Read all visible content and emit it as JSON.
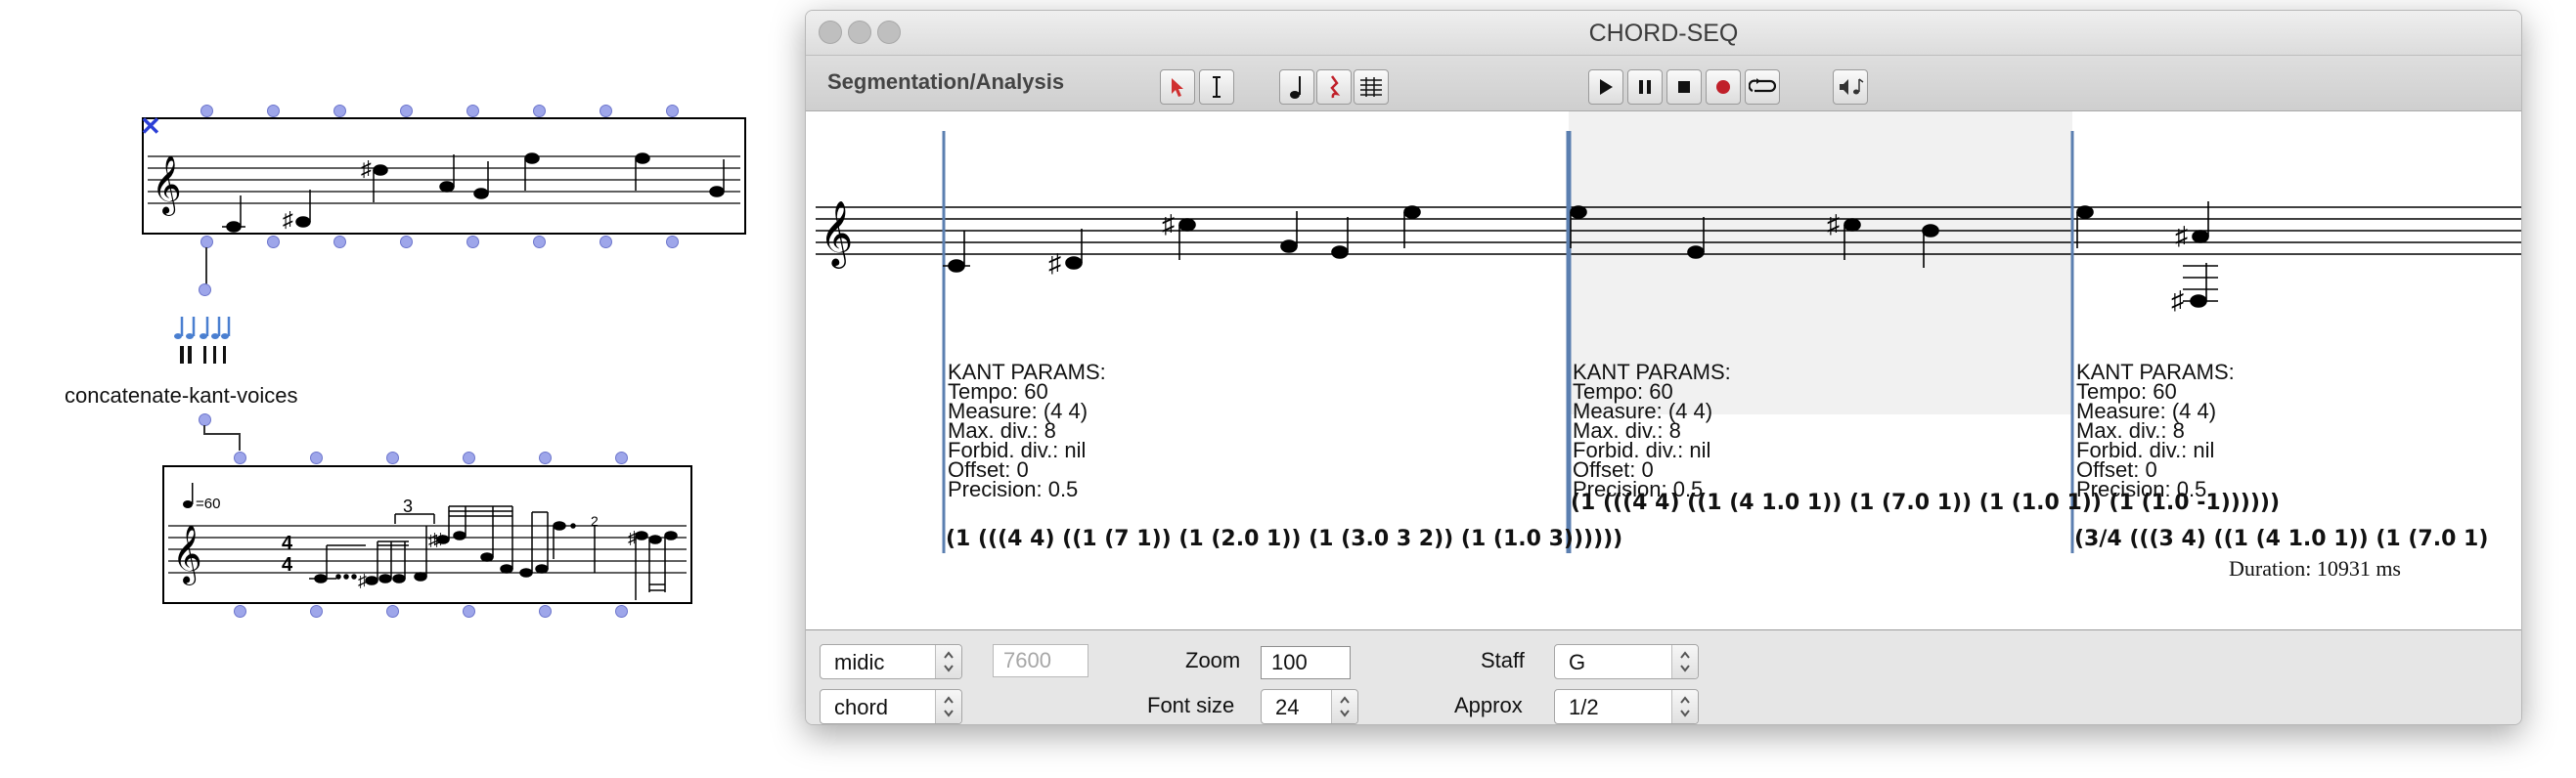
{
  "patch": {
    "kant_object_label": "concatenate-kant-voices",
    "input_score": {
      "clef": "treble-clef"
    },
    "output_score": {
      "tempo": "=60",
      "time_signature_top": "4",
      "time_signature_bottom": "4",
      "tuplet_label": "3",
      "small_number": "2"
    }
  },
  "window": {
    "title": "CHORD-SEQ",
    "toolbar": {
      "label": "Segmentation/Analysis",
      "tools": [
        "arrow-select-icon",
        "text-cursor-icon",
        "note-icon",
        "rest-icon",
        "score-grid-icon"
      ],
      "transport": [
        "play-icon",
        "pause-icon",
        "stop-icon",
        "record-icon",
        "loop-icon"
      ],
      "midi_icon": "speaker-note-icon"
    },
    "segments": [
      {
        "params_title": "KANT PARAMS:",
        "tempo": "Tempo: 60",
        "measure": "Measure: (4 4)",
        "max_div": "Max. div.: 8",
        "forbid": "Forbid. div.: nil",
        "offset": "Offset: 0",
        "precision": "Precision: 0.5",
        "tree": "(1 (((4 4) ((1 (7 1)) (1 (2.0 1)) (1 (3.0 3 2)) (1 (1.0 3))))))"
      },
      {
        "params_title": "KANT PARAMS:",
        "tempo": "Tempo: 60",
        "measure": "Measure: (4 4)",
        "max_div": "Max. div.: 8",
        "forbid": "Forbid. div.: nil",
        "offset": "Offset: 0",
        "precision": "Precision: 0.5",
        "tree": "(1 (((4 4) ((1 (4 1.0 1)) (1 (7.0 1)) (1 (1.0 1)) (1 (1.0 -1))))))"
      },
      {
        "params_title": "KANT PARAMS:",
        "tempo": "Tempo: 60",
        "measure": "Measure: (4 4)",
        "max_div": "Max. div.: 8",
        "forbid": "Forbid. div.: nil",
        "offset": "Offset: 0",
        "precision": "Precision: 0.5",
        "tree": "(3/4 (((3 4) ((1 (4 1.0 1)) (1 (7.0 1)"
      }
    ],
    "duration": "Duration: 10931 ms",
    "bottom": {
      "pitch_mode": "midic",
      "value_field": "7600",
      "display_mode": "chord",
      "zoom_label": "Zoom",
      "zoom_value": "100",
      "fontsize_label": "Font size",
      "fontsize_value": "24",
      "staff_label": "Staff",
      "staff_value": "G",
      "approx_label": "Approx",
      "approx_value": "1/2"
    },
    "colors": {
      "segment_marker": "#5b7fb0",
      "selection_fill": "#f1f1f1",
      "record": "#c0202a"
    }
  }
}
